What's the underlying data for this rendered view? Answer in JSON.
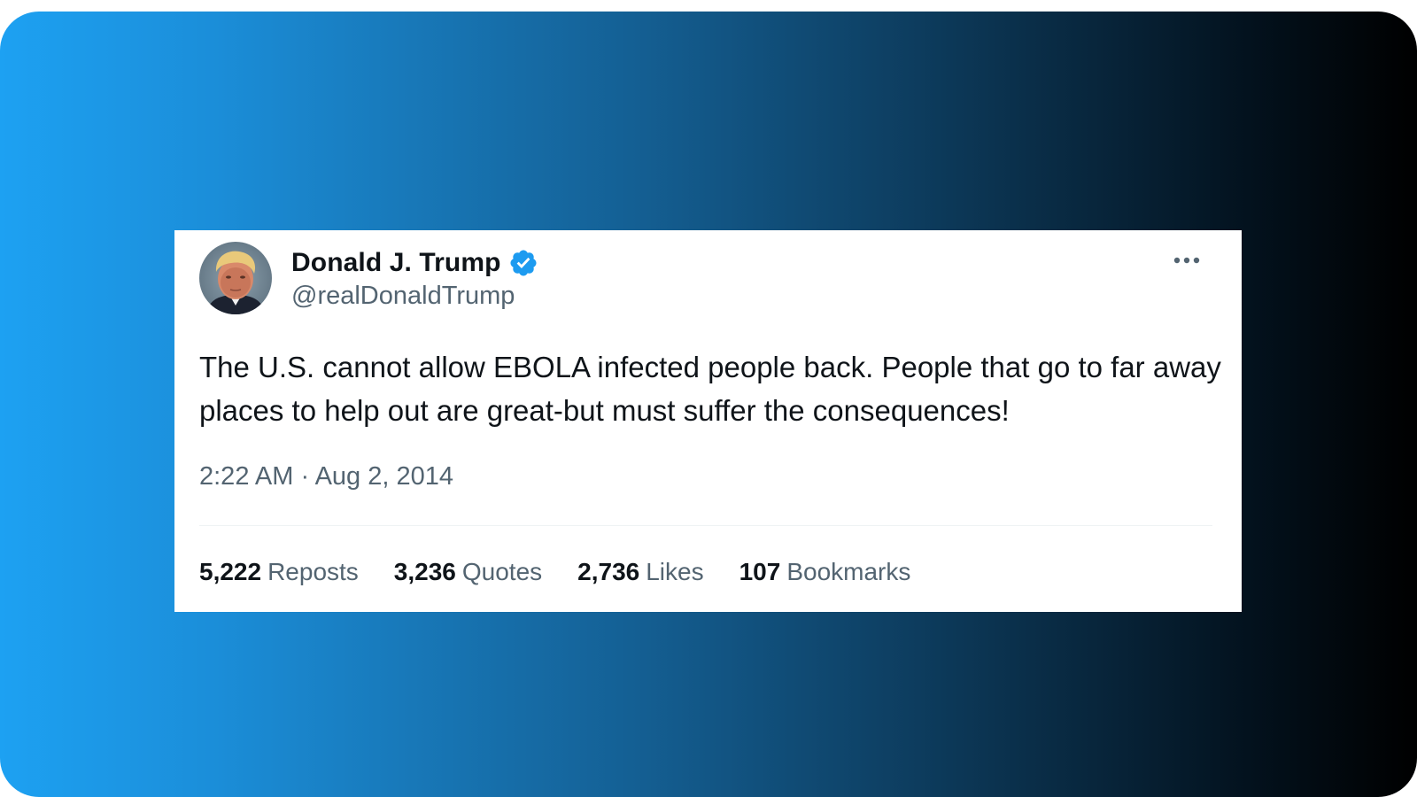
{
  "tweet": {
    "author": {
      "display_name": "Donald J. Trump",
      "handle": "@realDonaldTrump",
      "verified": true,
      "avatar_icon": "profile-photo"
    },
    "text": "The U.S. cannot allow EBOLA infected people back. People that go to far away places to help out are great-but must suffer the consequences!",
    "timestamp": "2:22 AM · Aug 2, 2014",
    "more_icon": "more-horizontal-icon",
    "stats": [
      {
        "count": "5,222",
        "label": "Reposts"
      },
      {
        "count": "3,236",
        "label": "Quotes"
      },
      {
        "count": "2,736",
        "label": "Likes"
      },
      {
        "count": "107",
        "label": "Bookmarks"
      }
    ]
  },
  "colors": {
    "verified_badge": "#1d9bf0",
    "gradient_start": "#1da1f2",
    "gradient_end": "#000000",
    "text_primary": "#0f1419",
    "text_secondary": "#536471"
  }
}
